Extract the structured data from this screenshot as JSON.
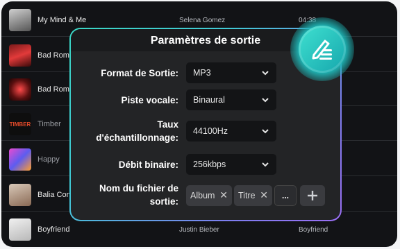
{
  "tracks": [
    {
      "title": "My Mind & Me",
      "artist": "Selena Gomez",
      "album": "04:38",
      "dim": false
    },
    {
      "title": "Bad Roma",
      "artist": "",
      "album": "",
      "dim": false
    },
    {
      "title": "Bad Roma",
      "artist": "",
      "album": "",
      "dim": false
    },
    {
      "title": "Timber",
      "artist": "",
      "album": "",
      "dim": true
    },
    {
      "title": "Happy",
      "artist": "",
      "album": "",
      "dim": true
    },
    {
      "title": "Balia Conn",
      "artist": "",
      "album": "",
      "dim": false
    },
    {
      "title": "Boyfriend",
      "artist": "Justin Bieber",
      "album": "Boyfriend",
      "dim": false
    }
  ],
  "covers": {
    "timber_text": "TIMBER"
  },
  "colors": {
    "accent_start": "#3ad6c4",
    "accent_end": "#9a6ef3",
    "badge": "#1fb8b8"
  },
  "dialog": {
    "title": "Paramètres de sortie",
    "format": {
      "label": "Format de Sortie:",
      "value": "MP3"
    },
    "voice": {
      "label": "Piste vocale:",
      "value": "Binaural"
    },
    "rate": {
      "label_line1": "Taux",
      "label_line2": "d'échantillonnage:",
      "value": "44100Hz"
    },
    "bitrate": {
      "label": "Débit binaire:",
      "value": "256kbps"
    },
    "filename": {
      "label_line1": "Nom du fichier de",
      "label_line2": "sortie:",
      "tags": [
        "Album",
        "Titre"
      ],
      "more_label": "...",
      "add_icon": "plus-icon"
    }
  },
  "badge_icon": "edit-list-icon"
}
